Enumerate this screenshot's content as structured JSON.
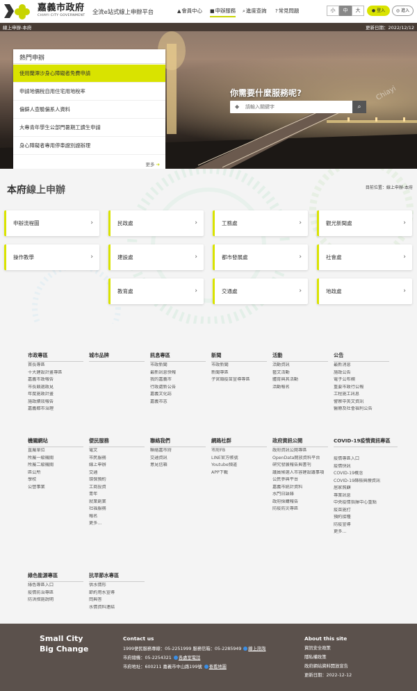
{
  "header": {
    "logo_name": "嘉義市政府",
    "logo_en": "CHIAYI CITY GOVERNMENT",
    "subtitle": "全流e站式線上申辦平台",
    "nav": [
      {
        "icon": "▲",
        "label": "會員中心"
      },
      {
        "icon": "■",
        "label": "申辦服務"
      },
      {
        "icon": "⌕",
        "label": "進度查詢"
      },
      {
        "icon": "?",
        "label": "常見問題"
      }
    ],
    "font_sizes": [
      "小",
      "中",
      "大"
    ],
    "login_label": "登入",
    "enter_label": "進入"
  },
  "hero": {
    "breadcrumb": "線上申辦-本府",
    "updated": "更新日期：2022/12/12",
    "hot_title": "熱門申辦",
    "hot_items": [
      "使用蘭潭沙身心障礙者免費申請",
      "申請地價稅自用住宅用地稅率",
      "偏僻人查驗偏系人資料",
      "大專青年學生公部門暑期工讀生申請",
      "身心障礙者專用停車證別證辦理"
    ],
    "more_label": "更多",
    "ask": "你需要什麼服務呢?",
    "search_placeholder": "請輸入關鍵字",
    "watermark": "Chiayi"
  },
  "services": {
    "title_a": "本府",
    "title_b": "線上申辦",
    "breadcrumb": "目前位置：線上申辦-本府",
    "cards": [
      "申辦流程圖",
      "民政處",
      "工務處",
      "觀光新聞處",
      "操作教學",
      "建設處",
      "都市發展處",
      "社會處",
      "教育處",
      "交通處",
      "地政處"
    ]
  },
  "sitemap": {
    "sections": [
      {
        "title": "市政專區",
        "links": [
          "首長專區",
          "十大建設計畫專區",
          "嘉義市政報告",
          "市長競選政見",
          "年度施政計畫",
          "施政績效報告",
          "嘉義都市治理"
        ]
      },
      {
        "title": "城市品牌",
        "links": []
      },
      {
        "title": "訊息專區",
        "links": [
          "市政新聞",
          "最新訊息快報",
          "我的嘉義市",
          "行政處新公告",
          "嘉義文化誌",
          "嘉義市志"
        ]
      },
      {
        "title": "新聞",
        "links": [
          "市政新聞",
          "新聞專區",
          "子宮頸疫苗宣導專區"
        ]
      },
      {
        "title": "活動",
        "links": [
          "活動資訊",
          "藝文活動",
          "體育與其活動",
          "活動報名"
        ]
      },
      {
        "title": "公告",
        "links": [
          "最新消息",
          "施政公告",
          "電子公布欄",
          "重要市政行公報",
          "工程施工訊息",
          "警察中英文資訊",
          "醫療及社會福利公告"
        ]
      },
      {
        "title": "機關網站",
        "links": [
          "直屬單位",
          "所屬一級機關",
          "所屬二級機關",
          "區公所",
          "學校",
          "公營事業"
        ]
      },
      {
        "title": "便民服務",
        "links": [
          "電文",
          "市民服務",
          "線上申辦",
          "交通",
          "環保預約",
          "工商投資",
          "青年",
          "就業創業",
          "社福服務",
          "報名",
          "更多..."
        ]
      },
      {
        "title": "聯絡我們",
        "links": [
          "聯絡嘉市府",
          "交通資訊",
          "意見信箱"
        ]
      },
      {
        "title": "網路社群",
        "links": [
          "市府FB",
          "LINE官方帳號",
          "Youtube頻道",
          "APP下載"
        ]
      },
      {
        "title": "政府資訊公開",
        "links": [
          "政府資訊公開專區",
          "OpenData開放資料平台",
          "研究發展報告與書刊",
          "議員候選人市容建設議事項",
          "公民參與平台",
          "嘉義市統計資料",
          "水門日語錄",
          "政府採購報告",
          "防疫防災專區"
        ]
      },
      {
        "title": "COVID-19疫情資訊專區",
        "links": [
          "疫情專區入口",
          "疫情快訊",
          "COVID-19概念",
          "COVID-19篩檢與療資訊",
          "居家照顧",
          "專業訊息",
          "中央疫情指揮中心重點",
          "疫苗施打",
          "預約接種",
          "防疫宣導",
          "更多..."
        ]
      },
      {
        "title": "綠色能源專區",
        "links": [
          "綠色專區入口",
          "疫情防治專區",
          "防洪措施說明"
        ]
      },
      {
        "title": "抗旱節水專區",
        "links": [
          "供水情形",
          "節約用水宣導",
          "問與答",
          "水情資料連結"
        ]
      }
    ]
  },
  "footer": {
    "slogan1": "Small City",
    "slogan2": "Big Change",
    "contact_title": "Contact us",
    "contact_line1": "1999便民服務專線：05-2251999 服務信箱：05-2285949",
    "contact_link1": "線上諮詢",
    "contact_line2": "市府總機：05-2254321",
    "contact_link2": "各處室電話",
    "contact_line3": "市府地址：600211 嘉義市中山路199號",
    "contact_link3": "查看地圖",
    "about_title": "About this site",
    "about_links": [
      "資訊安全政策",
      "隱私權政策",
      "政府網站資料開放宣告",
      "更新日期：2022-12-12"
    ]
  },
  "colors": {
    "accent": "#d9e300",
    "footer": "#5b514c",
    "panel_bg": "#f4f4f4"
  }
}
